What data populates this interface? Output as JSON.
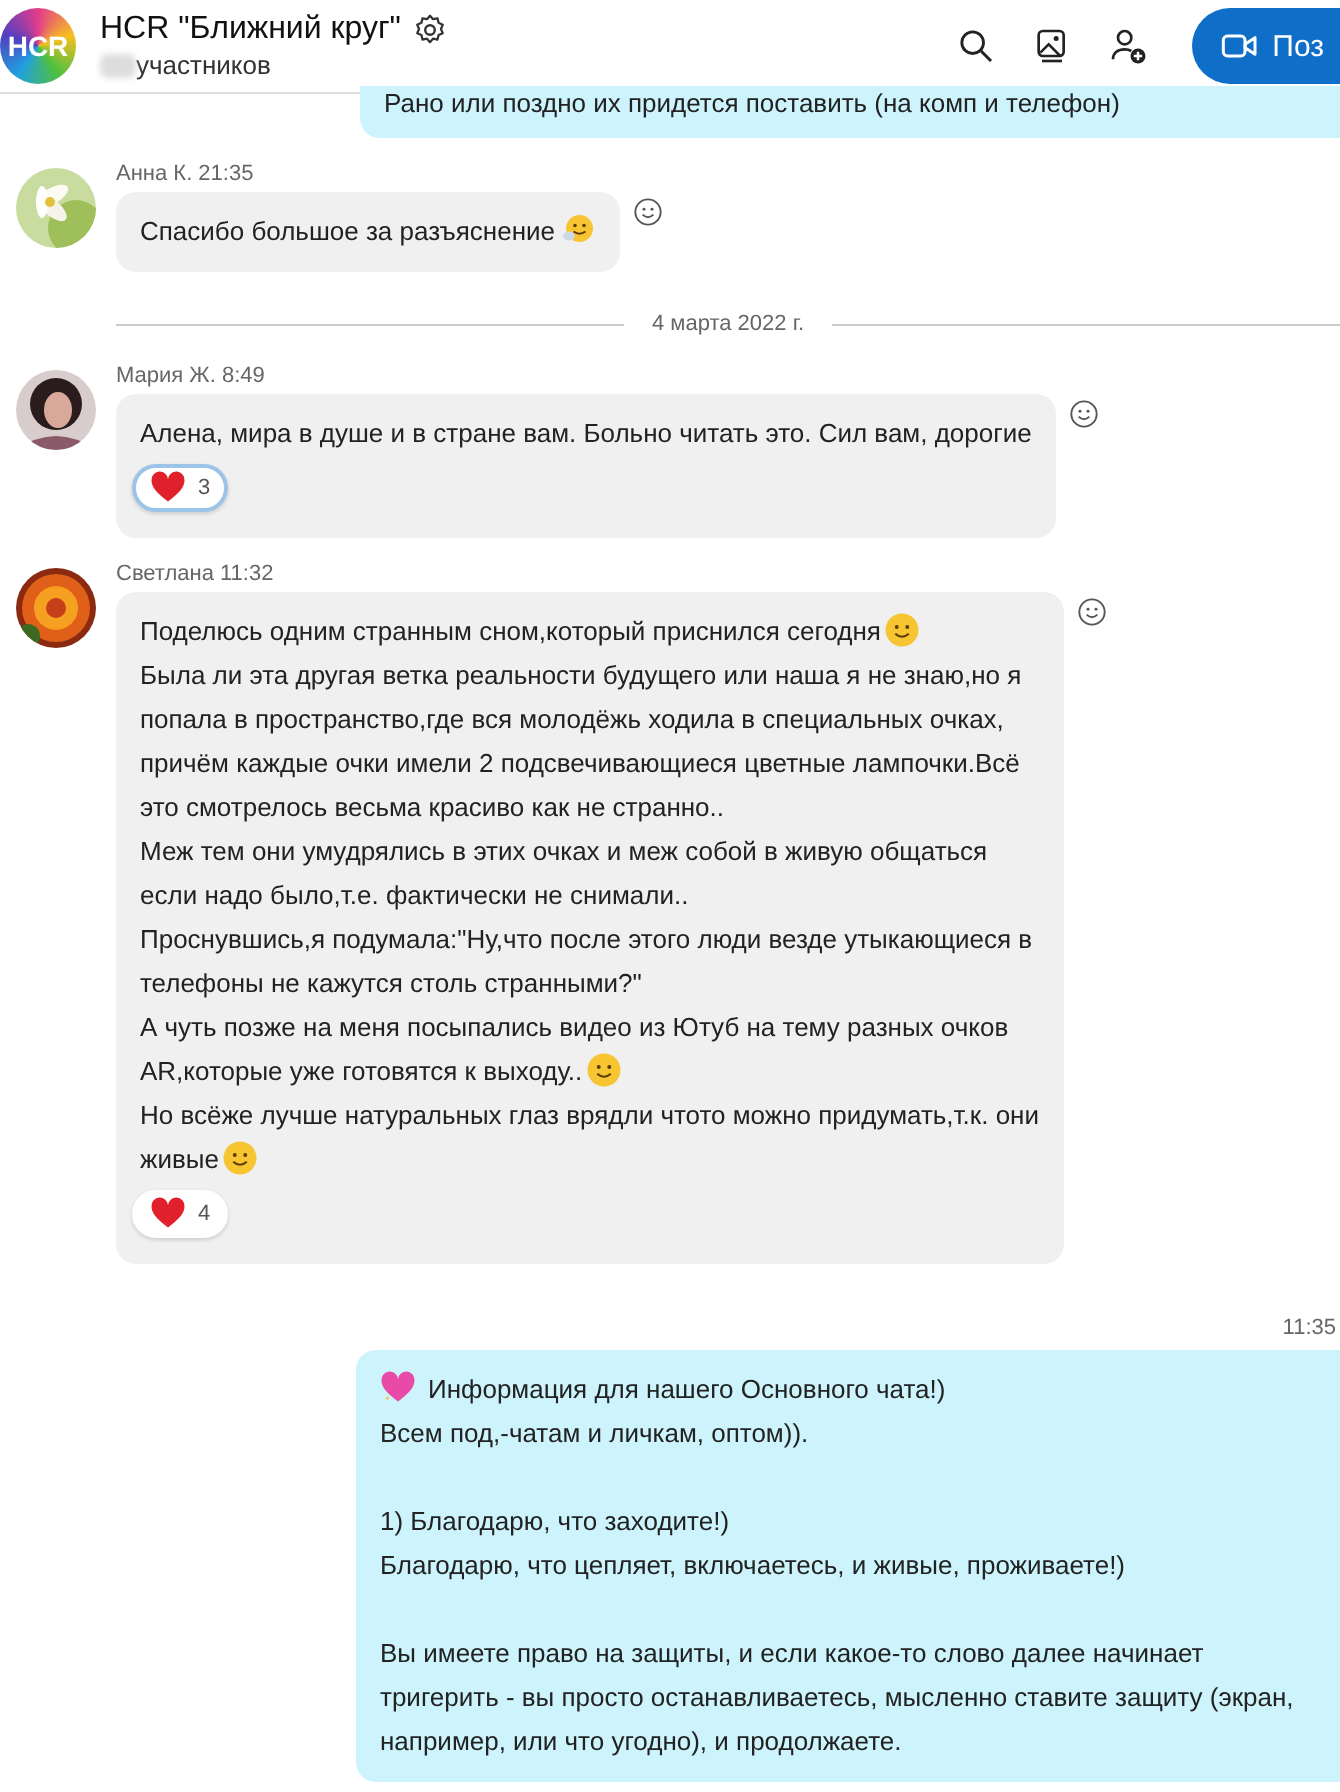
{
  "header": {
    "title": "HCR \"Ближний круг\"",
    "avatar_text": "HCR",
    "subtitle": "участников",
    "call_button": "Поз"
  },
  "messages": [
    {
      "kind": "outgoing",
      "lines": [
        {
          "text": "Рано или поздно их придется поставить (на комп и телефон)"
        }
      ]
    },
    {
      "kind": "incoming",
      "sender": "Анна К. 21:35",
      "lines": [
        {
          "text": "Спасибо большое за разъяснение",
          "emoji": true
        }
      ]
    },
    {
      "kind": "divider",
      "text": "4 марта 2022 г."
    },
    {
      "kind": "incoming",
      "sender": "Мария Ж. 8:49",
      "lines": [
        {
          "text": "Алена, мира в душе и в стране вам. Больно читать это. Сил вам, дорогие"
        }
      ],
      "reaction": {
        "count": "3",
        "selected": true
      }
    },
    {
      "kind": "incoming",
      "sender": "Светлана 11:32",
      "lines": [
        {
          "text": "Поделюсь одним странным сном,который приснился сегодня",
          "emoji": true
        },
        {
          "text": "Была ли эта другая ветка реальности будущего или наша я не знаю,но я"
        },
        {
          "text": "попала в пространство,где вся молодёжь ходила в специальных очках,"
        },
        {
          "text": "причём каждые очки имели 2 подсвечивающиеся цветные лампочки.Всё"
        },
        {
          "text": "это смотрелось весьма красиво как не странно.."
        },
        {
          "text": "Меж тем они умудрялись в этих очках и меж собой в живую общаться"
        },
        {
          "text": "если надо было,т.е. фактически не снимали.."
        },
        {
          "text": "Проснувшись,я подумала:\"Ну,что после этого люди везде утыкающиеся в"
        },
        {
          "text": "телефоны не кажутся столь странными?\""
        },
        {
          "text": "А чуть позже на меня посыпались видео из Ютуб на тему разных очков"
        },
        {
          "text": "AR,которые уже готовятся к выходу..",
          "emoji": true
        },
        {
          "text": "Но всёже лучше натуральных глаз врядли чтото можно придумать,т.к. они"
        },
        {
          "text": "живые",
          "emoji": true
        }
      ],
      "reaction": {
        "count": "4",
        "selected": false
      }
    },
    {
      "kind": "outgoing",
      "time": "11:35",
      "lines": [
        {
          "text": "Информация для нашего Основного чата!)",
          "heart": true
        },
        {
          "text": "Всем под,-чатам и личкам, оптом))."
        },
        {
          "text": "1) Благодарю, что заходите!)",
          "space_before": true
        },
        {
          "text": "Благодарю, что цепляет, включаетесь, и живые, проживаете!)"
        },
        {
          "text": "Вы имеете право на защиты, и если какое-то слово далее начинает",
          "space_before": true
        },
        {
          "text": "тригерить - вы просто останавливаетесь, мысленно ставите защиту (экран,"
        },
        {
          "text": "например, или что угодно), и продолжаете."
        }
      ]
    }
  ]
}
